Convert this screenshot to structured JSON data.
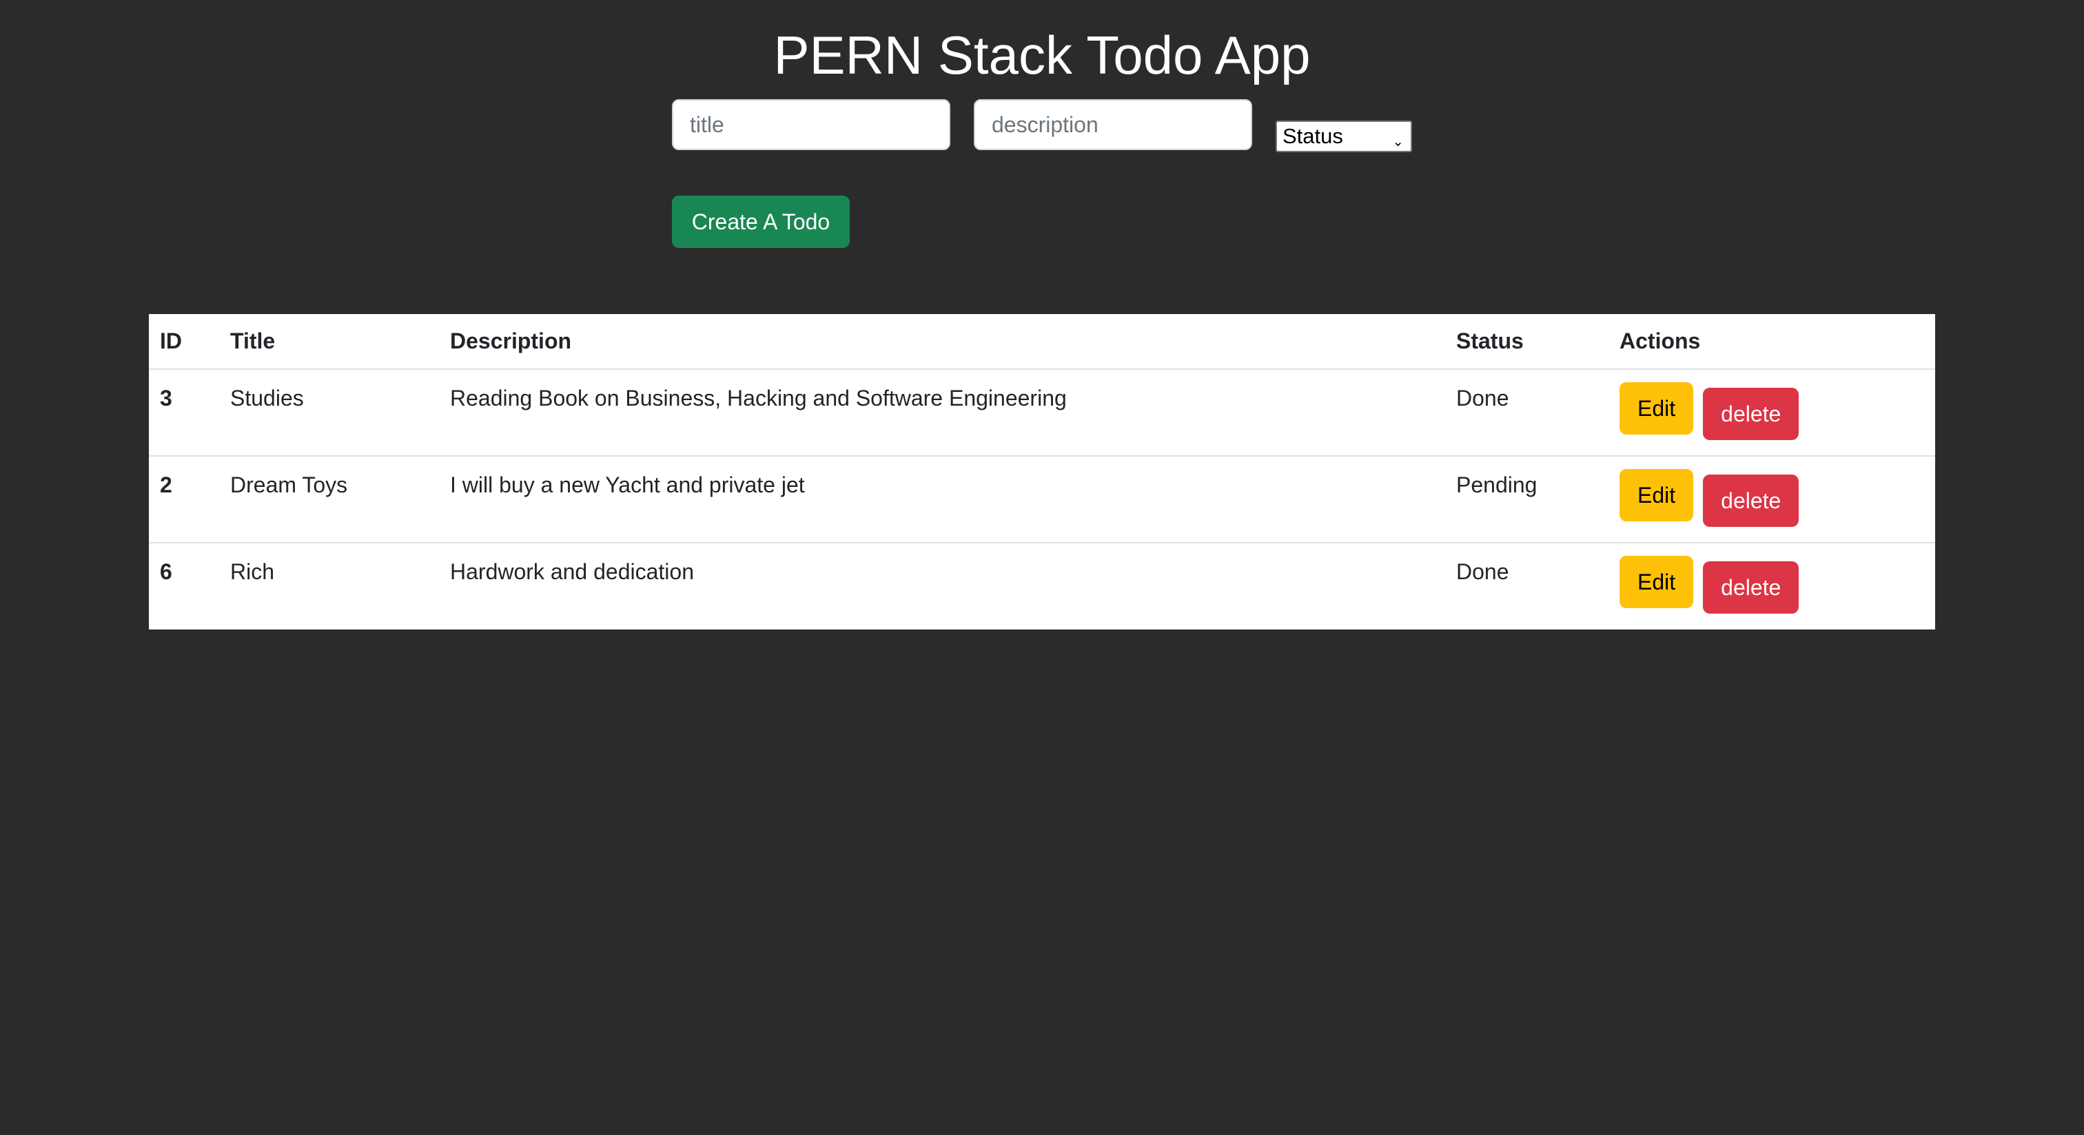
{
  "header": {
    "title": "PERN Stack Todo App"
  },
  "form": {
    "title_placeholder": "title",
    "description_placeholder": "description",
    "status_selected": "Status",
    "create_label": "Create A Todo"
  },
  "table": {
    "headers": [
      "ID",
      "Title",
      "Description",
      "Status",
      "Actions"
    ],
    "rows": [
      {
        "id": "3",
        "title": "Studies",
        "description": "Reading Book on Business, Hacking and Software Engineering",
        "status": "Done"
      },
      {
        "id": "2",
        "title": "Dream Toys",
        "description": "I will buy a new Yacht and private jet",
        "status": "Pending"
      },
      {
        "id": "6",
        "title": "Rich",
        "description": "Hardwork and dedication",
        "status": "Done"
      }
    ],
    "edit_label": "Edit",
    "delete_label": "delete"
  },
  "colors": {
    "background": "#2b2b2b",
    "create_button": "#198754",
    "edit_button": "#ffc107",
    "delete_button": "#dc3545"
  }
}
